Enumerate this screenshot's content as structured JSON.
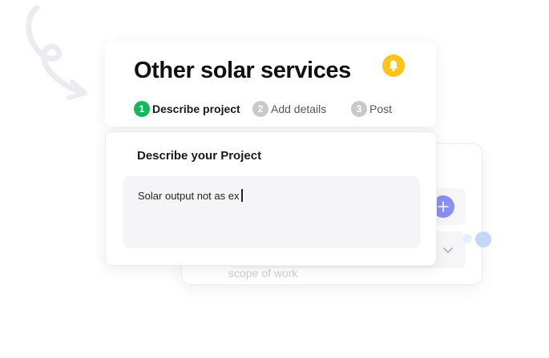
{
  "header": {
    "title": "Other solar services",
    "notification_icon": "bell-icon",
    "accent_color": "#fcc419"
  },
  "steps": [
    {
      "number": "1",
      "label": "Describe project",
      "active": true
    },
    {
      "number": "2",
      "label": "Add details",
      "active": false
    },
    {
      "number": "3",
      "label": "Post",
      "active": false
    }
  ],
  "form": {
    "label": "Describe your Project",
    "value": "Solar output not as ex"
  },
  "background_card": {
    "hint_text": "scope of work",
    "add_icon": "plus-icon",
    "dropdown_icon": "chevron-down-icon"
  },
  "colors": {
    "step_active": "#16b75a",
    "step_inactive": "#c9c9c9",
    "add_button": "#8a8ff2"
  }
}
